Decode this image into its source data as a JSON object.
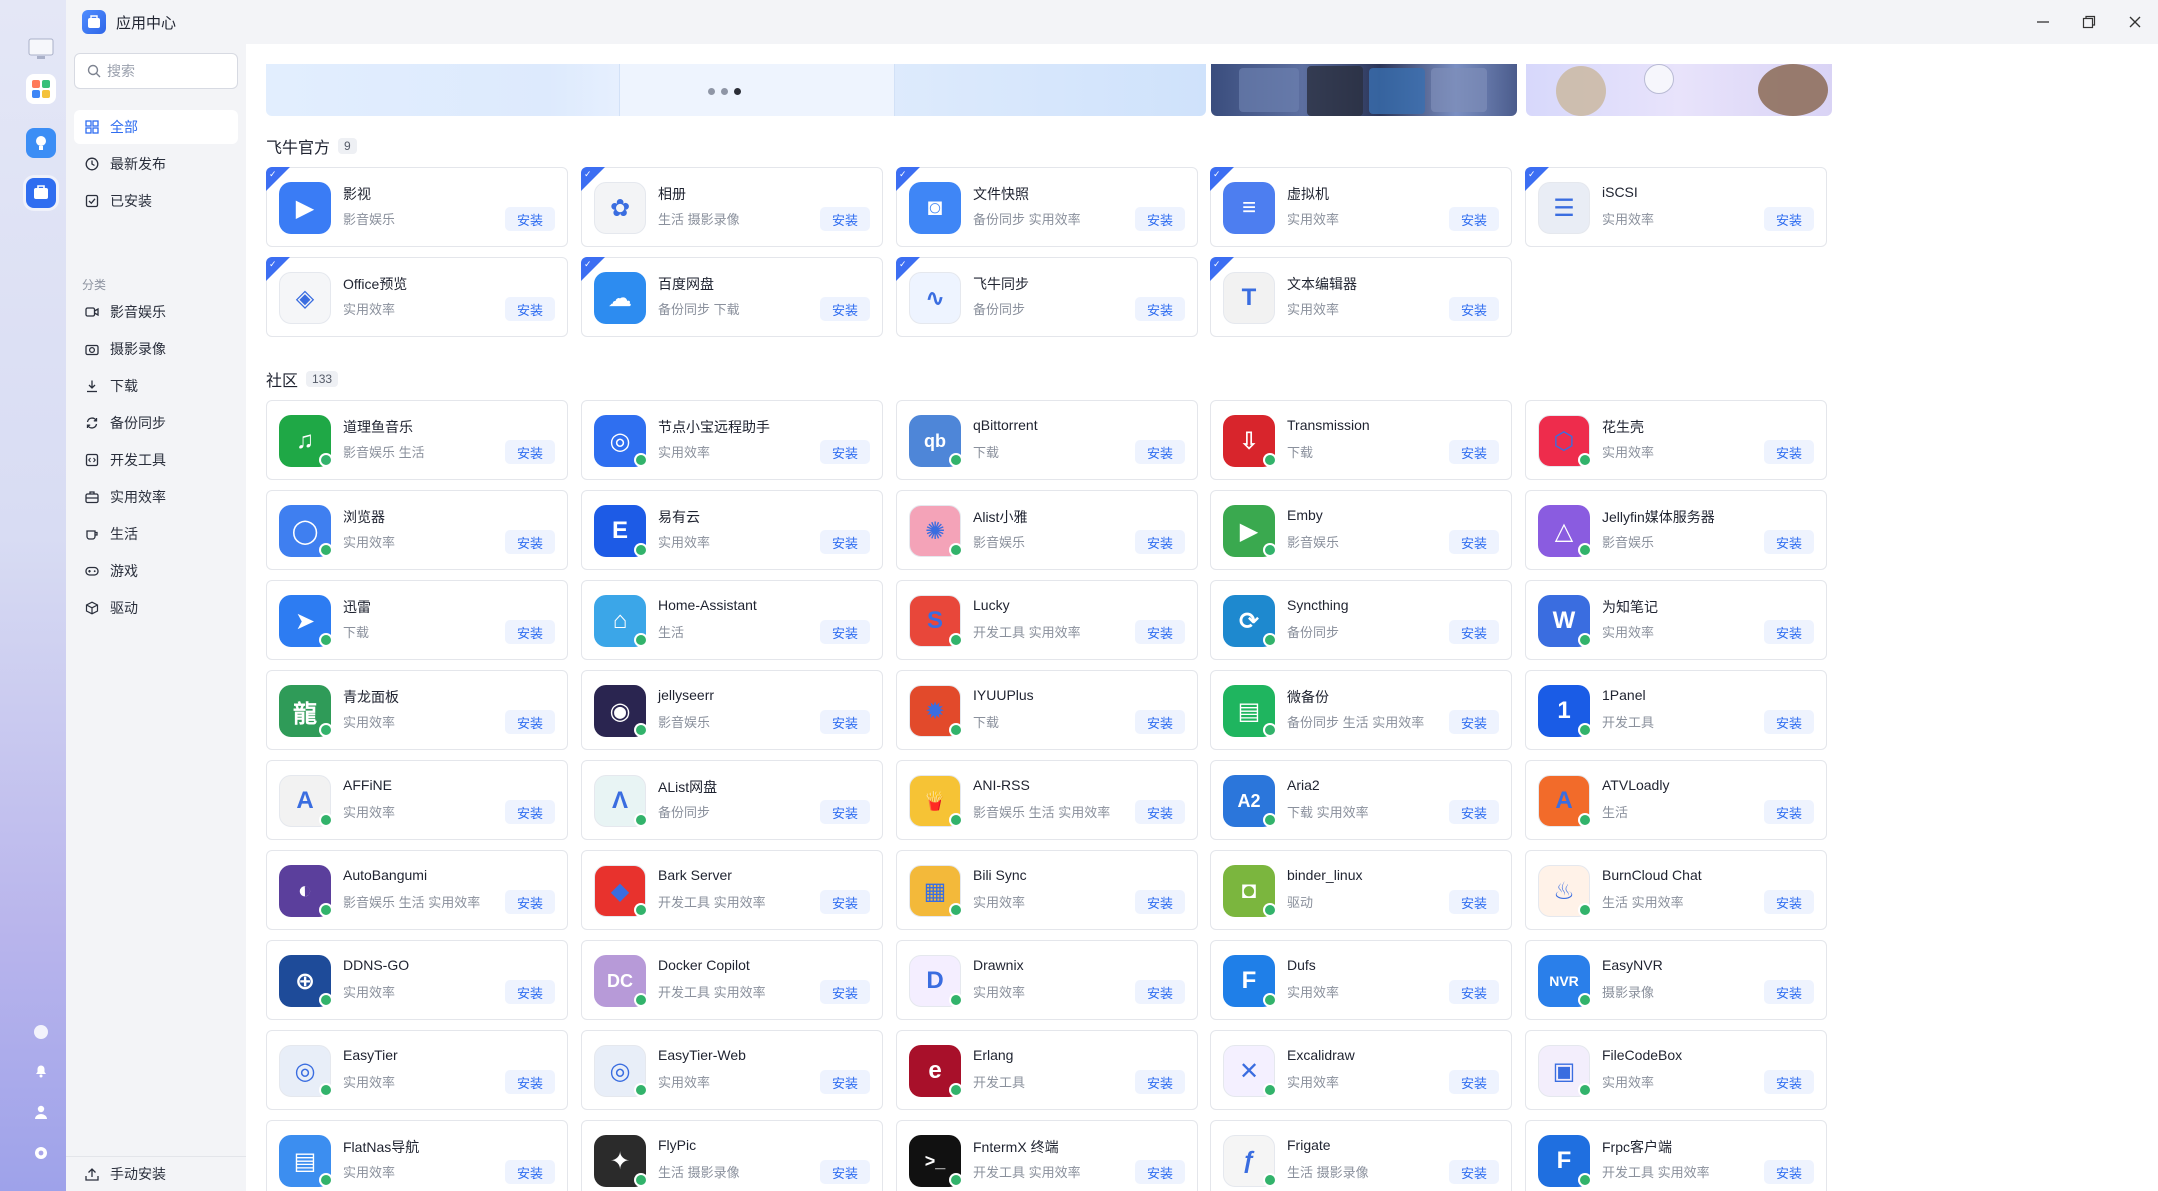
{
  "window": {
    "title": "应用中心"
  },
  "sidebar": {
    "search_placeholder": "搜索",
    "top_items": [
      {
        "label": "全部",
        "icon": "grid-icon",
        "active": true
      },
      {
        "label": "最新发布",
        "icon": "clock-icon",
        "active": false
      },
      {
        "label": "已安装",
        "icon": "installed-icon",
        "active": false
      }
    ],
    "category_heading": "分类",
    "categories": [
      {
        "label": "影音娱乐",
        "icon": "video-icon"
      },
      {
        "label": "摄影录像",
        "icon": "camera-icon"
      },
      {
        "label": "下载",
        "icon": "download-icon"
      },
      {
        "label": "备份同步",
        "icon": "sync-icon"
      },
      {
        "label": "开发工具",
        "icon": "code-icon"
      },
      {
        "label": "实用效率",
        "icon": "toolbox-icon"
      },
      {
        "label": "生活",
        "icon": "coffee-icon"
      },
      {
        "label": "游戏",
        "icon": "gamepad-icon"
      },
      {
        "label": "驱动",
        "icon": "cube-icon"
      }
    ],
    "manual_install": "手动安装"
  },
  "sections": [
    {
      "title": "飞牛官方",
      "count": "9",
      "apps": [
        {
          "name": "影视",
          "tags": "影音娱乐",
          "color": "#3a7cf5",
          "glyph": "▶"
        },
        {
          "name": "相册",
          "tags": "生活 摄影录像",
          "color": "#f3f4f6",
          "glyph": "✿"
        },
        {
          "name": "文件快照",
          "tags": "备份同步 实用效率",
          "color": "#3f86f6",
          "glyph": "◙"
        },
        {
          "name": "虚拟机",
          "tags": "实用效率",
          "color": "#4d7ef0",
          "glyph": "≡"
        },
        {
          "name": "iSCSI",
          "tags": "实用效率",
          "color": "#e9edf5",
          "glyph": "☰"
        },
        {
          "name": "Office预览",
          "tags": "实用效率",
          "color": "#f5f6f8",
          "glyph": "◈"
        },
        {
          "name": "百度网盘",
          "tags": "备份同步 下载",
          "color": "#2d8cf0",
          "glyph": "☁"
        },
        {
          "name": "飞牛同步",
          "tags": "备份同步",
          "color": "#eef4ff",
          "glyph": "∿"
        },
        {
          "name": "文本编辑器",
          "tags": "实用效率",
          "color": "#f2f2f2",
          "glyph": "T"
        }
      ]
    },
    {
      "title": "社区",
      "count": "133",
      "apps": [
        {
          "name": "道理鱼音乐",
          "tags": "影音娱乐 生活",
          "color": "#1fa846",
          "glyph": "♫"
        },
        {
          "name": "节点小宝远程助手",
          "tags": "实用效率",
          "color": "#2f6ff0",
          "glyph": "◎"
        },
        {
          "name": "qBittorrent",
          "tags": "下载",
          "color": "#4e86d8",
          "glyph": "qb"
        },
        {
          "name": "Transmission",
          "tags": "下载",
          "color": "#d8252c",
          "glyph": "⇩"
        },
        {
          "name": "花生壳",
          "tags": "实用效率",
          "color": "#ee2c4c",
          "glyph": "⬡"
        },
        {
          "name": "浏览器",
          "tags": "实用效率",
          "color": "#3f7ff0",
          "glyph": "◯"
        },
        {
          "name": "易有云",
          "tags": "实用效率",
          "color": "#1d5be6",
          "glyph": "E"
        },
        {
          "name": "Alist小雅",
          "tags": "影音娱乐",
          "color": "#f4a3b8",
          "glyph": "✺"
        },
        {
          "name": "Emby",
          "tags": "影音娱乐",
          "color": "#3aa94f",
          "glyph": "▶"
        },
        {
          "name": "Jellyfin媒体服务器",
          "tags": "影音娱乐",
          "color": "#8a5ce0",
          "glyph": "△"
        },
        {
          "name": "迅雷",
          "tags": "下载",
          "color": "#2d7cf2",
          "glyph": "➤"
        },
        {
          "name": "Home-Assistant",
          "tags": "生活",
          "color": "#3ba6e8",
          "glyph": "⌂"
        },
        {
          "name": "Lucky",
          "tags": "开发工具 实用效率",
          "color": "#e8473a",
          "glyph": "S"
        },
        {
          "name": "Syncthing",
          "tags": "备份同步",
          "color": "#1e89cf",
          "glyph": "⟳"
        },
        {
          "name": "为知笔记",
          "tags": "实用效率",
          "color": "#3a6de0",
          "glyph": "W"
        },
        {
          "name": "青龙面板",
          "tags": "实用效率",
          "color": "#2f9b58",
          "glyph": "龍"
        },
        {
          "name": "jellyseerr",
          "tags": "影音娱乐",
          "color": "#2a2550",
          "glyph": "◉"
        },
        {
          "name": "IYUUPlus",
          "tags": "下载",
          "color": "#e24a2b",
          "glyph": "✹"
        },
        {
          "name": "微备份",
          "tags": "备份同步 生活 实用效率",
          "color": "#1fb55f",
          "glyph": "▤"
        },
        {
          "name": "1Panel",
          "tags": "开发工具",
          "color": "#1a5ce6",
          "glyph": "1"
        },
        {
          "name": "AFFiNE",
          "tags": "实用效率",
          "color": "#f2f2f2",
          "glyph": "A"
        },
        {
          "name": "AList网盘",
          "tags": "备份同步",
          "color": "#e8f4f4",
          "glyph": "Λ"
        },
        {
          "name": "ANI-RSS",
          "tags": "影音娱乐 生活 实用效率",
          "color": "#f6c335",
          "glyph": "🍟"
        },
        {
          "name": "Aria2",
          "tags": "下载 实用效率",
          "color": "#2b76db",
          "glyph": "A2"
        },
        {
          "name": "ATVLoadly",
          "tags": "生活",
          "color": "#f26b2a",
          "glyph": "A"
        },
        {
          "name": "AutoBangumi",
          "tags": "影音娱乐 生活 实用效率",
          "color": "#5b3f9c",
          "glyph": "◐"
        },
        {
          "name": "Bark Server",
          "tags": "开发工具 实用效率",
          "color": "#e8322d",
          "glyph": "◆"
        },
        {
          "name": "Bili Sync",
          "tags": "实用效率",
          "color": "#f3b93a",
          "glyph": "▦"
        },
        {
          "name": "binder_linux",
          "tags": "驱动",
          "color": "#7bb63e",
          "glyph": "◘"
        },
        {
          "name": "BurnCloud Chat",
          "tags": "生活 实用效率",
          "color": "#fff2e8",
          "glyph": "♨"
        },
        {
          "name": "DDNS-GO",
          "tags": "实用效率",
          "color": "#1e4b99",
          "glyph": "⊕"
        },
        {
          "name": "Docker Copilot",
          "tags": "开发工具 实用效率",
          "color": "#b79ad8",
          "glyph": "DC"
        },
        {
          "name": "Drawnix",
          "tags": "实用效率",
          "color": "#f4eeff",
          "glyph": "D"
        },
        {
          "name": "Dufs",
          "tags": "实用效率",
          "color": "#1f7fe8",
          "glyph": "F"
        },
        {
          "name": "EasyNVR",
          "tags": "摄影录像",
          "color": "#2a7fea",
          "glyph": "NVR"
        },
        {
          "name": "EasyTier",
          "tags": "实用效率",
          "color": "#e8eef8",
          "glyph": "◎"
        },
        {
          "name": "EasyTier-Web",
          "tags": "实用效率",
          "color": "#e8eef8",
          "glyph": "◎"
        },
        {
          "name": "Erlang",
          "tags": "开发工具",
          "color": "#a8102a",
          "glyph": "e"
        },
        {
          "name": "Excalidraw",
          "tags": "实用效率",
          "color": "#f4f0ff",
          "glyph": "✕"
        },
        {
          "name": "FileCodeBox",
          "tags": "实用效率",
          "color": "#f3eefc",
          "glyph": "▣"
        },
        {
          "name": "FlatNas导航",
          "tags": "实用效率",
          "color": "#3c8ef0",
          "glyph": "▤"
        },
        {
          "name": "FlyPic",
          "tags": "生活 摄影录像",
          "color": "#2b2b2b",
          "glyph": "✦"
        },
        {
          "name": "FntermX 终端",
          "tags": "开发工具 实用效率",
          "color": "#111111",
          "glyph": ">_"
        },
        {
          "name": "Frigate",
          "tags": "生活 摄影录像",
          "color": "#f5f5f5",
          "glyph": "ƒ"
        },
        {
          "name": "Frpc客户端",
          "tags": "开发工具 实用效率",
          "color": "#1f6fe0",
          "glyph": "F"
        }
      ]
    }
  ],
  "install_label": "安装",
  "colors": {
    "accent": "#2f6df0",
    "install_bg": "#eef3fe",
    "official_badge": "#3c6ef2"
  }
}
